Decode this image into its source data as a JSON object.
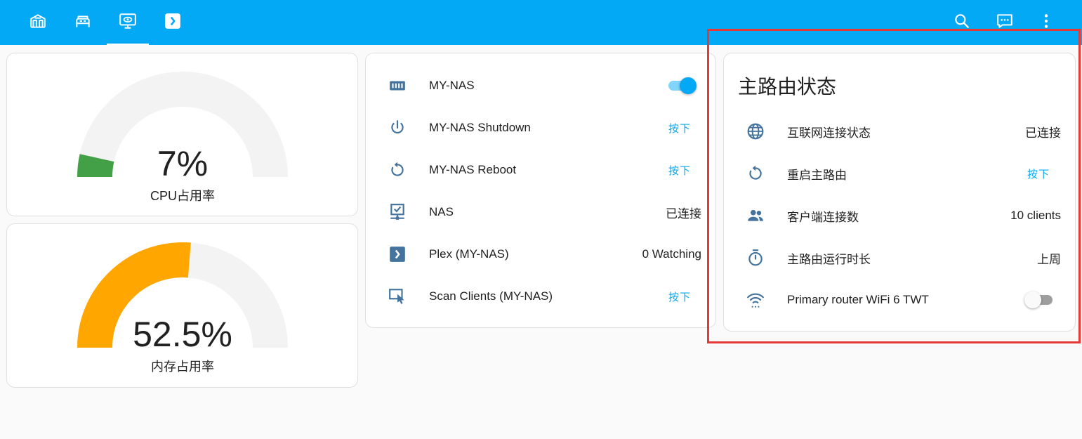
{
  "header": {
    "tabs": [
      {
        "icon": "home-icon"
      },
      {
        "icon": "bed-icon"
      },
      {
        "icon": "monitor-eye-icon",
        "active": true
      },
      {
        "icon": "plex-icon"
      }
    ],
    "actions": [
      {
        "icon": "search-icon"
      },
      {
        "icon": "assist-chat-icon"
      },
      {
        "icon": "more-vertical-icon"
      }
    ],
    "bar_color": "#03a9f4"
  },
  "gauges": [
    {
      "value_text": "7%",
      "label": "CPU占用率",
      "value_percent": 7,
      "color": "#43a047"
    },
    {
      "value_text": "52.5%",
      "label": "内存占用率",
      "value_percent": 52.5,
      "color": "#ffa600"
    }
  ],
  "nas_card": {
    "rows": [
      {
        "icon": "nas-icon",
        "name": "MY-NAS",
        "type": "toggle",
        "on": true
      },
      {
        "icon": "power-icon",
        "name": "MY-NAS Shutdown",
        "type": "button",
        "action": "按下"
      },
      {
        "icon": "restart-icon",
        "name": "MY-NAS Reboot",
        "type": "button",
        "action": "按下"
      },
      {
        "icon": "monitor-network-icon",
        "name": "NAS",
        "type": "state",
        "state": "已连接"
      },
      {
        "icon": "plex-icon",
        "name": "Plex (MY-NAS)",
        "type": "state",
        "state": "0 Watching"
      },
      {
        "icon": "cast-touch-icon",
        "name": "Scan Clients (MY-NAS)",
        "type": "button",
        "action": "按下"
      }
    ]
  },
  "router_card": {
    "title": "主路由状态",
    "rows": [
      {
        "icon": "globe-icon",
        "name": "互联网连接状态",
        "type": "state",
        "state": "已连接"
      },
      {
        "icon": "restart-icon",
        "name": "重启主路由",
        "type": "button",
        "action": "按下"
      },
      {
        "icon": "account-group-icon",
        "name": "客户端连接数",
        "type": "state",
        "state": "10 clients"
      },
      {
        "icon": "timer-icon",
        "name": "主路由运行时长",
        "type": "state",
        "state": "上周"
      },
      {
        "icon": "wifi-icon",
        "name": "Primary router WiFi 6 TWT",
        "type": "toggle",
        "on": false
      }
    ]
  },
  "colors": {
    "accent": "#03a9f4",
    "icon": "#44739e",
    "highlight": "#e53935"
  }
}
